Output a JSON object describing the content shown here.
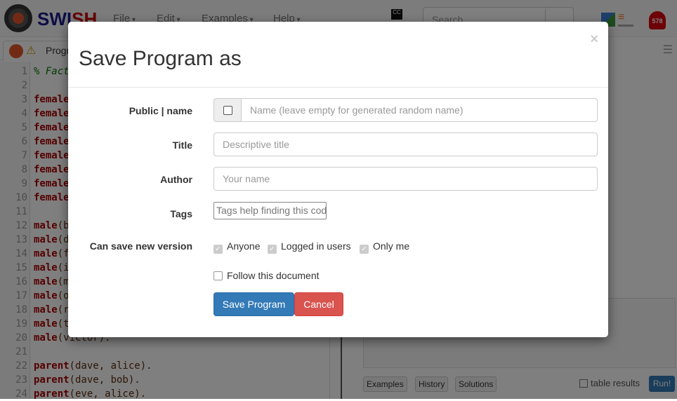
{
  "navbar": {
    "brand_a": "SWI",
    "brand_b": "SH",
    "menus": [
      "File",
      "Edit",
      "Examples",
      "Help"
    ],
    "search_placeholder": "Search",
    "notification_count": "578",
    "cc_label": "CC"
  },
  "tab": {
    "label": "Progra"
  },
  "editor": {
    "lines": [
      {
        "n": "1",
        "kw": "",
        "rest": "% Fact",
        "comment": true
      },
      {
        "n": "2",
        "kw": "",
        "rest": ""
      },
      {
        "n": "3",
        "kw": "female",
        "rest": ""
      },
      {
        "n": "4",
        "kw": "female",
        "rest": ""
      },
      {
        "n": "5",
        "kw": "female",
        "rest": ""
      },
      {
        "n": "6",
        "kw": "female",
        "rest": ""
      },
      {
        "n": "7",
        "kw": "female",
        "rest": ""
      },
      {
        "n": "8",
        "kw": "female",
        "rest": ""
      },
      {
        "n": "9",
        "kw": "female",
        "rest": ""
      },
      {
        "n": "10",
        "kw": "female",
        "rest": ""
      },
      {
        "n": "11",
        "kw": "",
        "rest": ""
      },
      {
        "n": "12",
        "kw": "male",
        "rest": "(b"
      },
      {
        "n": "13",
        "kw": "male",
        "rest": "(d"
      },
      {
        "n": "14",
        "kw": "male",
        "rest": "(f"
      },
      {
        "n": "15",
        "kw": "male",
        "rest": "(i"
      },
      {
        "n": "16",
        "kw": "male",
        "rest": "(m"
      },
      {
        "n": "17",
        "kw": "male",
        "rest": "(o"
      },
      {
        "n": "18",
        "kw": "male",
        "rest": "(r"
      },
      {
        "n": "19",
        "kw": "male",
        "rest": "(t"
      },
      {
        "n": "20",
        "kw": "male",
        "rest": "(victor)."
      },
      {
        "n": "21",
        "kw": "",
        "rest": ""
      },
      {
        "n": "22",
        "kw": "parent",
        "rest": "(dave, alice)."
      },
      {
        "n": "23",
        "kw": "parent",
        "rest": "(dave, bob)."
      },
      {
        "n": "24",
        "kw": "parent",
        "rest": "(eve, alice)."
      }
    ]
  },
  "query": {
    "buttons": [
      "Examples",
      "History",
      "Solutions"
    ],
    "table_results": "table results",
    "run": "Run!"
  },
  "modal": {
    "title": "Save Program as",
    "close": "×",
    "fields": {
      "name_label": "Public | name",
      "name_placeholder": "Name (leave empty for generated random name)",
      "public_checked": false,
      "title_label": "Title",
      "title_placeholder": "Descriptive title",
      "author_label": "Author",
      "author_placeholder": "Your name",
      "tags_label": "Tags",
      "tags_placeholder": "Tags help finding this code"
    },
    "save_label": "Can save new version",
    "permissions": [
      {
        "label": "Anyone",
        "checked": true
      },
      {
        "label": "Logged in users",
        "checked": true
      },
      {
        "label": "Only me",
        "checked": true
      }
    ],
    "follow_label": "Follow this document",
    "follow_checked": false,
    "save_button": "Save Program",
    "cancel_button": "Cancel",
    "colors": {
      "primary": "#337ab7",
      "danger": "#d9534f"
    }
  }
}
